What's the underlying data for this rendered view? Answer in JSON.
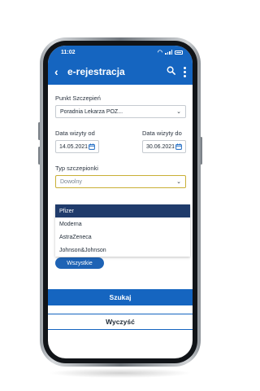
{
  "status_bar": {
    "time": "11:02"
  },
  "app_bar": {
    "title": "e-rejestracja",
    "back_icon": "chevron-left-icon",
    "search_icon": "search-icon",
    "menu_icon": "more-vertical-icon"
  },
  "form": {
    "punkt_label": "Punkt Szczepień",
    "punkt_value": "Poradnia Lekarza POZ...",
    "date_from_label": "Data wizyty od",
    "date_from_value": "14.05.2021",
    "date_to_label": "Data wizyty do",
    "date_to_value": "30.06.2021",
    "typ_label": "Typ szczepionki",
    "typ_value": "Dowolny",
    "typ_options": [
      "Pfizer",
      "Moderna",
      "AstraZeneca",
      "Johnson&Johnson"
    ],
    "typ_highlighted": "Pfizer",
    "wszystkie_label": "Wszystkie"
  },
  "actions": {
    "search_label": "Szukaj",
    "clear_label": "Wyczyść"
  },
  "colors": {
    "primary": "#1565c0",
    "highlight": "#1f3b6b",
    "focus_border": "#c9b037"
  }
}
